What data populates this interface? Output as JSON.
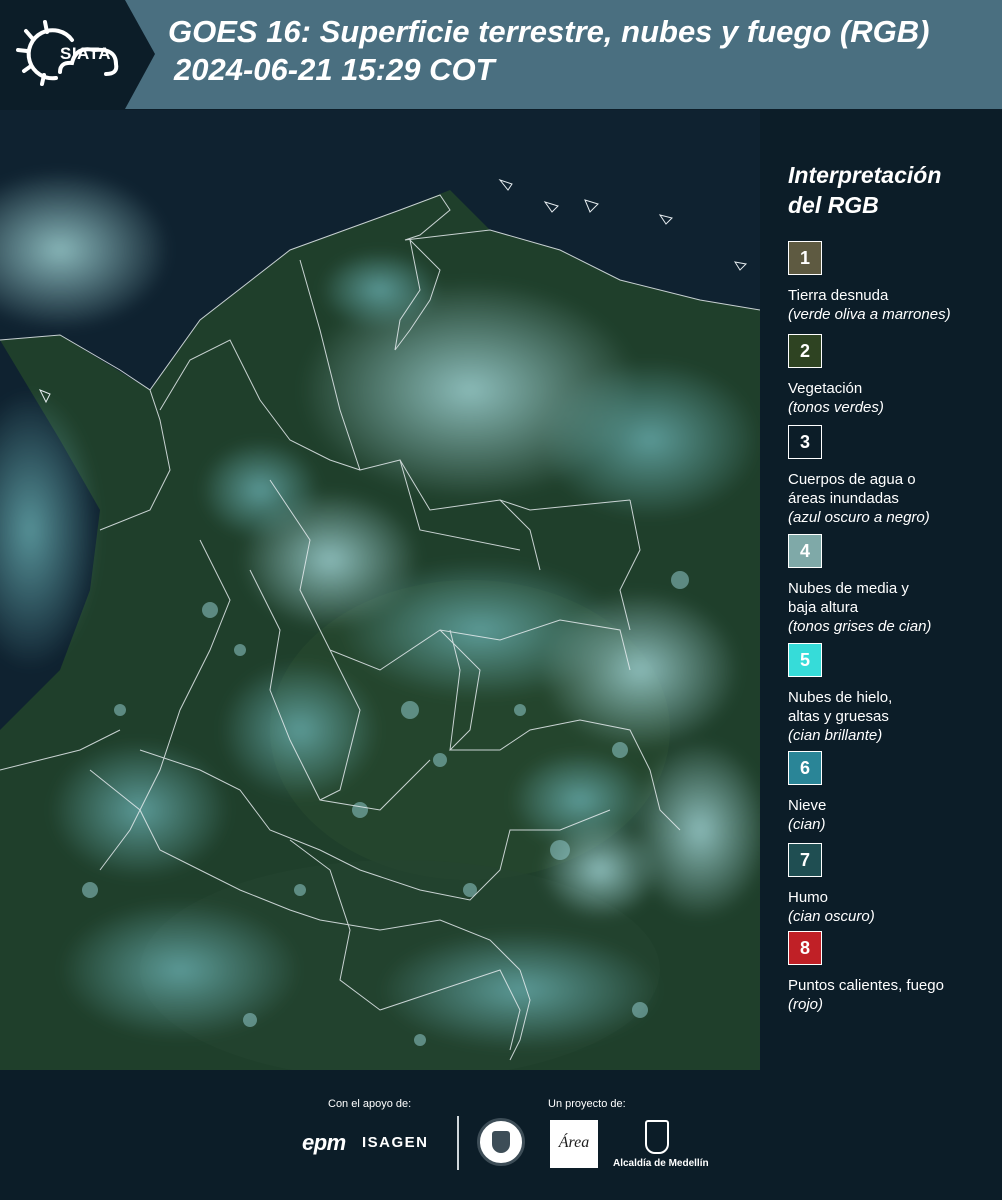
{
  "header": {
    "logo_text": "SIATA",
    "title_line1": "GOES 16: Superficie terrestre, nubes y fuego (RGB)",
    "title_line2": "2024-06-21 15:29 COT"
  },
  "colors": {
    "header_bg": "#4a6f80",
    "page_bg": "#0c1d28",
    "vegetation": "#1c3e2c",
    "cloud": "#7fc4c6",
    "ocean": "#0b1a24",
    "border_lines": "#e6ecef"
  },
  "legend": {
    "title_line1": "Interpretación",
    "title_line2": "del RGB",
    "items": [
      {
        "number": "1",
        "color": "#5e5a41",
        "label_lines": [
          "Tierra desnuda"
        ],
        "sub": "(verde oliva a marrones)"
      },
      {
        "number": "2",
        "color": "#2e4322",
        "label_lines": [
          "Vegetación"
        ],
        "sub": "(tonos verdes)"
      },
      {
        "number": "3",
        "color": "#0c1d28",
        "label_lines": [
          "Cuerpos de agua o",
          "áreas inundadas"
        ],
        "sub": "(azul oscuro a negro)"
      },
      {
        "number": "4",
        "color": "#7fa9a8",
        "label_lines": [
          "Nubes de media y",
          "baja altura"
        ],
        "sub": "(tonos grises de cian)"
      },
      {
        "number": "5",
        "color": "#36dcd9",
        "label_lines": [
          "Nubes de hielo,",
          "altas y gruesas"
        ],
        "sub": "(cian brillante)"
      },
      {
        "number": "6",
        "color": "#2a8597",
        "label_lines": [
          "Nieve"
        ],
        "sub": "(cian)"
      },
      {
        "number": "7",
        "color": "#1f4e52",
        "label_lines": [
          "Humo"
        ],
        "sub": "(cian oscuro)"
      },
      {
        "number": "8",
        "color": "#c02026",
        "label_lines": [
          "Puntos calientes, fuego"
        ],
        "sub": "(rojo)"
      }
    ]
  },
  "footer": {
    "support_caption": "Con el apoyo de:",
    "project_caption": "Un proyecto de:",
    "sponsor1": "epm",
    "sponsor2": "ISAGEN",
    "partner_area": "Área",
    "partner_medellin": "Alcaldía de Medellín"
  }
}
